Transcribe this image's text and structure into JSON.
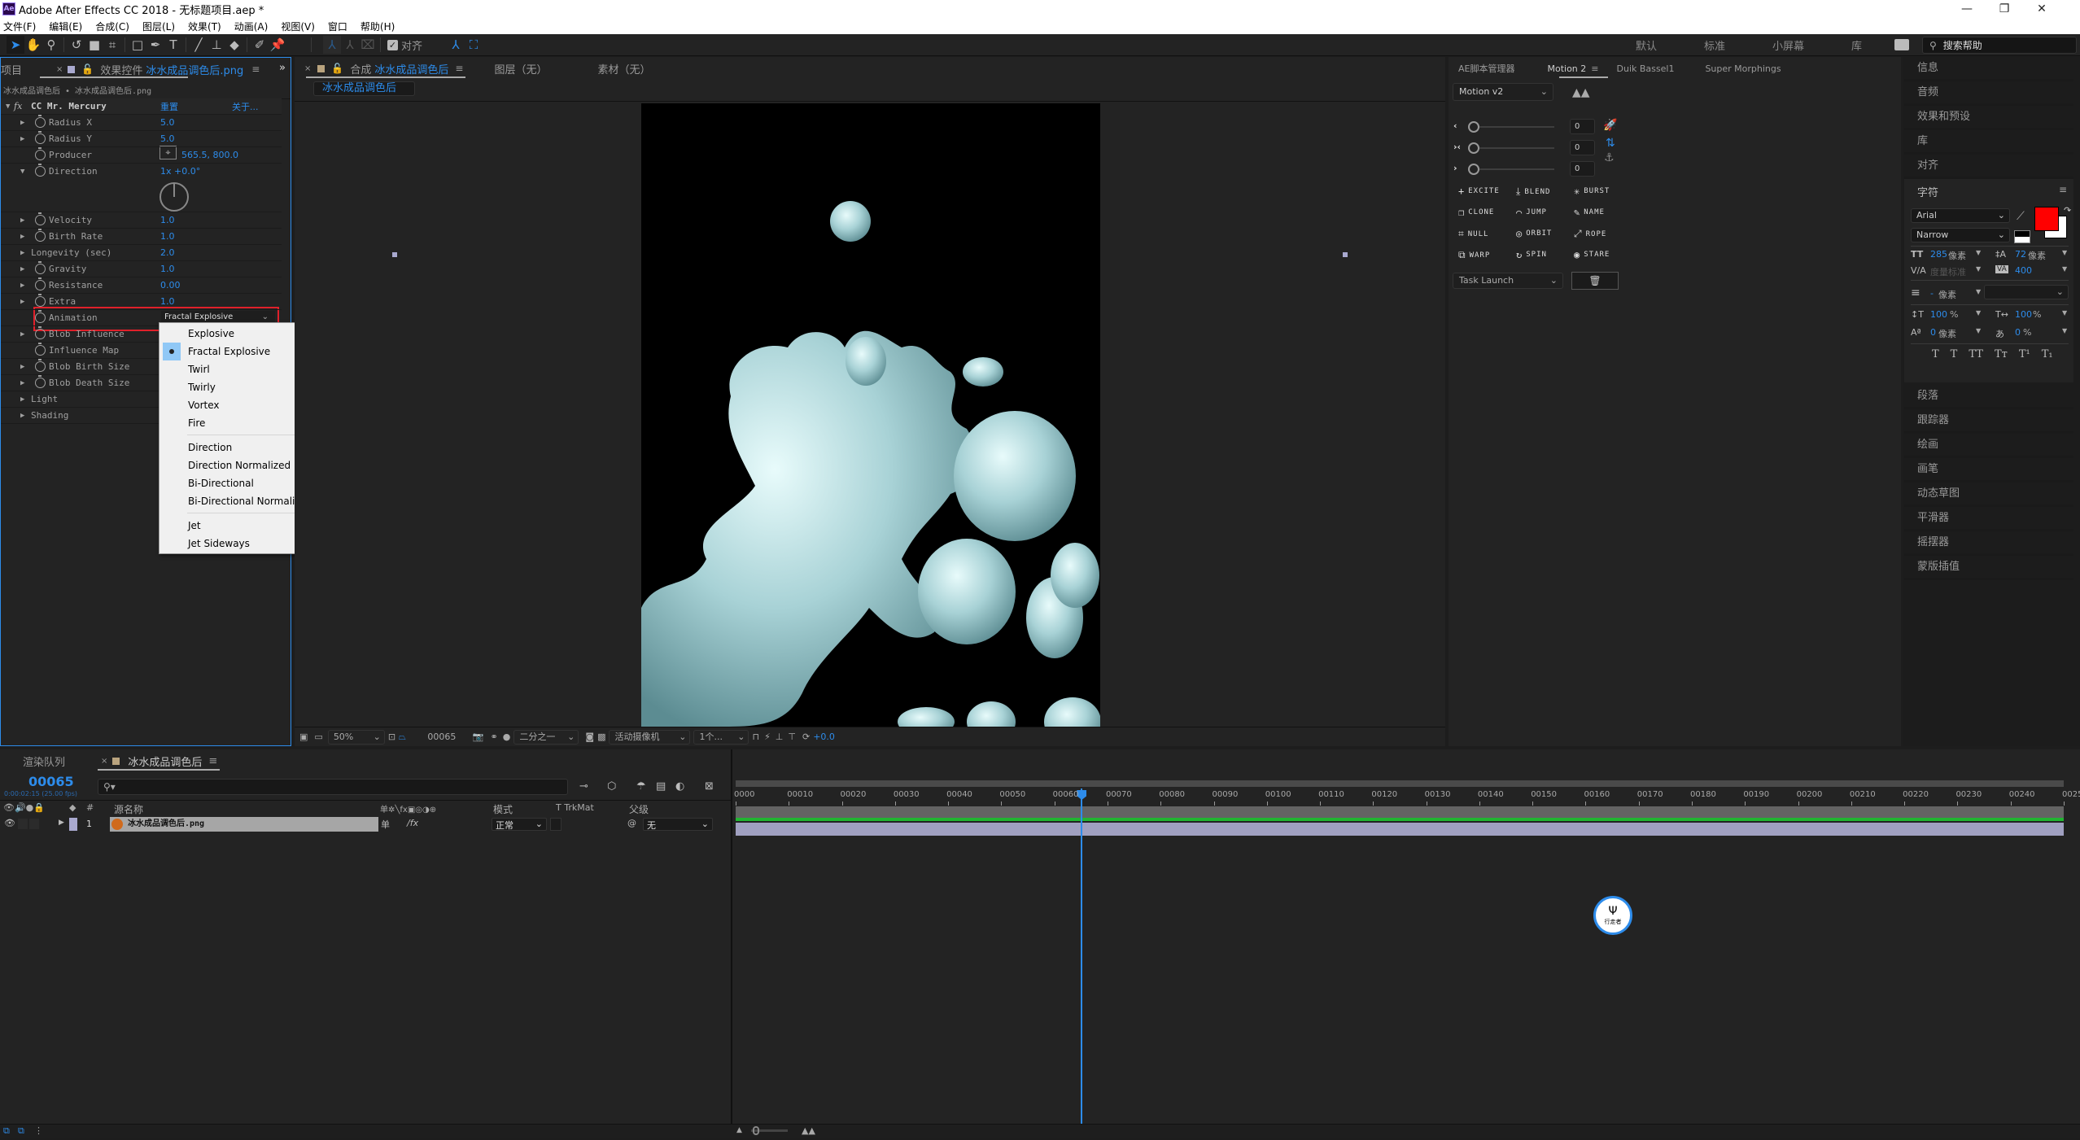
{
  "app": {
    "title": "Adobe After Effects CC 2018 - 无标题项目.aep *",
    "logo": "Ae",
    "window_controls": [
      "minimize-icon",
      "restore-icon",
      "close-icon"
    ]
  },
  "menu": [
    "文件(F)",
    "编辑(E)",
    "合成(C)",
    "图层(L)",
    "效果(T)",
    "动画(A)",
    "视图(V)",
    "窗口",
    "帮助(H)"
  ],
  "toolbar": {
    "snap_label": "对齐",
    "snap_checked": true,
    "workspaces": [
      "默认",
      "标准",
      "小屏幕",
      "库"
    ],
    "more": "»",
    "search_placeholder": "搜索帮助"
  },
  "left_panel": {
    "project_tab": "项目",
    "effect_tab_prefix": "效果控件",
    "effect_tab_name": "冰水成品调色后.png",
    "breadcrumb": "冰水成品调色后 • 冰水成品调色后.png",
    "effect": {
      "name": "CC Mr. Mercury",
      "reset": "重置",
      "about": "关于...",
      "properties": [
        {
          "name": "Radius X",
          "value": "5.0",
          "expand": true,
          "stopwatch": true
        },
        {
          "name": "Radius Y",
          "value": "5.0",
          "expand": true,
          "stopwatch": true
        },
        {
          "name": "Producer",
          "value": "565.5, 800.0",
          "expand": false,
          "stopwatch": true
        },
        {
          "name": "Direction",
          "value": "1x +0.0°",
          "expand": true,
          "stopwatch": true
        },
        {
          "name": "Velocity",
          "value": "1.0",
          "expand": true,
          "stopwatch": true
        },
        {
          "name": "Birth Rate",
          "value": "1.0",
          "expand": true,
          "stopwatch": true
        },
        {
          "name": "Longevity (sec)",
          "value": "2.0",
          "expand": true,
          "stopwatch": false
        },
        {
          "name": "Gravity",
          "value": "1.0",
          "expand": true,
          "stopwatch": true
        },
        {
          "name": "Resistance",
          "value": "0.00",
          "expand": true,
          "stopwatch": true
        },
        {
          "name": "Extra",
          "value": "1.0",
          "expand": true,
          "stopwatch": true
        },
        {
          "name": "Animation",
          "value": "Fractal Explosive",
          "expand": false,
          "stopwatch": true
        },
        {
          "name": "Blob Influence",
          "value": "",
          "expand": true,
          "stopwatch": true
        },
        {
          "name": "Influence Map",
          "value": "",
          "expand": false,
          "stopwatch": true
        },
        {
          "name": "Blob Birth Size",
          "value": "",
          "expand": true,
          "stopwatch": true
        },
        {
          "name": "Blob Death Size",
          "value": "",
          "expand": true,
          "stopwatch": true
        },
        {
          "name": "Light",
          "value": "",
          "expand": true,
          "stopwatch": false
        },
        {
          "name": "Shading",
          "value": "",
          "expand": true,
          "stopwatch": false
        }
      ]
    },
    "animation_dropdown": {
      "selected": "Fractal Explosive",
      "groups": [
        [
          "Explosive",
          "Fractal Explosive",
          "Twirl",
          "Twirly",
          "Vortex",
          "Fire"
        ],
        [
          "Direction",
          "Direction Normalized",
          "Bi-Directional",
          "Bi-Directional Normalized"
        ],
        [
          "Jet",
          "Jet Sideways"
        ]
      ]
    }
  },
  "comp_panel": {
    "tab_prefix": "合成",
    "tab_name": "冰水成品调色后",
    "layer_tab": "图层（无）",
    "footage_tab": "素材（无）",
    "comp_chip": "冰水成品调色后",
    "footer": {
      "zoom": "50%",
      "frame": "00065",
      "resolution": "二分之一",
      "camera": "活动摄像机",
      "views": "1个...",
      "exposure": "+0.0"
    }
  },
  "motion_panel": {
    "tabs": [
      "AE脚本管理器",
      "Motion 2",
      "Duik Bassel1",
      "Super Morphings"
    ],
    "active_tab": "Motion 2",
    "preset": "Motion v2",
    "sliders": [
      {
        "icon": "ease-in-icon",
        "glyph": "‹",
        "value": "0"
      },
      {
        "icon": "ease-both-icon",
        "glyph": "›‹",
        "value": "0"
      },
      {
        "icon": "ease-out-icon",
        "glyph": "›",
        "value": "0"
      }
    ],
    "buttons": [
      {
        "label": "EXCITE",
        "icon": "plus-icon",
        "glyph": "+"
      },
      {
        "label": "BLEND",
        "icon": "blend-icon",
        "glyph": "⤓"
      },
      {
        "label": "BURST",
        "icon": "burst-icon",
        "glyph": "✳"
      },
      {
        "label": "CLONE",
        "icon": "clone-icon",
        "glyph": "❐"
      },
      {
        "label": "JUMP",
        "icon": "jump-icon",
        "glyph": "⌒"
      },
      {
        "label": "NAME",
        "icon": "pencil-icon",
        "glyph": "✎"
      },
      {
        "label": "NULL",
        "icon": "null-icon",
        "glyph": "⌗"
      },
      {
        "label": "ORBIT",
        "icon": "orbit-icon",
        "glyph": "◎"
      },
      {
        "label": "ROPE",
        "icon": "rope-icon",
        "glyph": "⤢"
      },
      {
        "label": "WARP",
        "icon": "warp-icon",
        "glyph": "⧉"
      },
      {
        "label": "SPIN",
        "icon": "spin-icon",
        "glyph": "↻"
      },
      {
        "label": "STARE",
        "icon": "eye-icon",
        "glyph": "◉"
      }
    ],
    "task": "Task Launch"
  },
  "right_panel": {
    "collapsed_top": [
      "信息",
      "音频",
      "效果和预设",
      "库",
      "对齐"
    ],
    "character": {
      "title": "字符",
      "font": "Arial",
      "style": "Narrow",
      "fill_color": "#ff0000",
      "size": "285",
      "size_unit": "像素",
      "leading": "72",
      "leading_unit": "像素",
      "kerning": "度量标准",
      "tracking": "400",
      "stroke": "-",
      "stroke_unit": "像素",
      "vscale": "100",
      "hscale": "100",
      "baseline": "0",
      "baseline_unit": "像素",
      "tsume": "0",
      "pct": "%",
      "styles": [
        "T",
        "T",
        "TT",
        "Tт",
        "T¹",
        "T₁"
      ]
    },
    "collapsed_bottom": [
      "段落",
      "跟踪器",
      "绘画",
      "画笔",
      "动态草图",
      "平滑器",
      "摇摆器",
      "蒙版插值"
    ]
  },
  "timeline": {
    "render_tab": "渲染队列",
    "comp_tab": "冰水成品调色后",
    "current_frame": "00065",
    "timecode": "0:00:02:15 (25.00 fps)",
    "columns": {
      "source": "源名称",
      "mode": "模式",
      "trkmat": "T  TrkMat",
      "parent": "父级",
      "num": "#"
    },
    "layers": [
      {
        "index": "1",
        "name": "冰水成品调色后.png",
        "mode": "正常",
        "parent": "无",
        "label_color": "#a9a9cf"
      }
    ],
    "ruler": [
      "0000",
      "00010",
      "00020",
      "00030",
      "00040",
      "00050",
      "00060",
      "00070",
      "00080",
      "00090",
      "00100",
      "00110",
      "00120",
      "00130",
      "00140",
      "00150",
      "00160",
      "00170",
      "00180",
      "00190",
      "00200",
      "00210",
      "00220",
      "00230",
      "00240",
      "0025"
    ],
    "playhead_frame": 65,
    "total_frames": 250,
    "accent": "#2d8ceb",
    "work_area_color": "#21b531"
  },
  "watermark": {
    "text": "行走者"
  }
}
